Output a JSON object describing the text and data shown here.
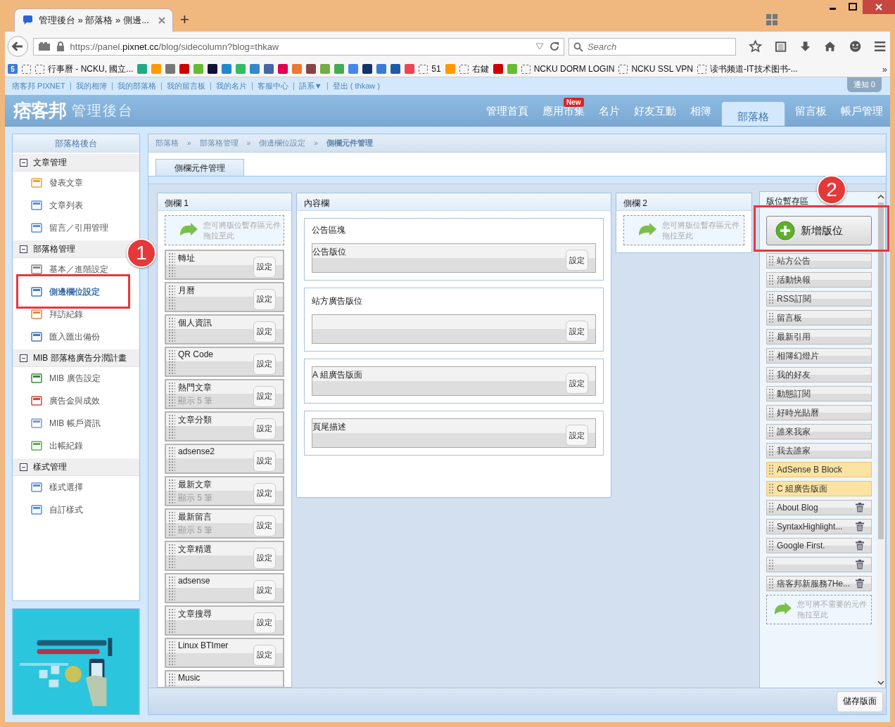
{
  "browser": {
    "tab_title": "管理後台 » 部落格 » 側邊...",
    "new_tab": "+",
    "url_host_pre": "https://panel.",
    "url_host": "pixnet.cc",
    "url_path": "/blog/sidecolumn?blog=thkaw",
    "search_placeholder": "Search",
    "bookmarks": [
      {
        "kind": "icon",
        "label": "5"
      },
      {
        "kind": "link"
      },
      {
        "kind": "link",
        "label": "行事曆 - NCKU, 國立..."
      },
      {
        "kind": "icon"
      },
      {
        "kind": "icon"
      },
      {
        "kind": "icon"
      },
      {
        "kind": "icon"
      },
      {
        "kind": "icon"
      },
      {
        "kind": "icon"
      },
      {
        "kind": "icon"
      },
      {
        "kind": "icon"
      },
      {
        "kind": "icon"
      },
      {
        "kind": "icon"
      },
      {
        "kind": "icon"
      },
      {
        "kind": "icon"
      },
      {
        "kind": "icon"
      },
      {
        "kind": "icon"
      },
      {
        "kind": "icon"
      },
      {
        "kind": "icon"
      },
      {
        "kind": "icon"
      },
      {
        "kind": "icon"
      },
      {
        "kind": "icon"
      },
      {
        "kind": "icon"
      },
      {
        "kind": "link",
        "label": "51"
      },
      {
        "kind": "icon"
      },
      {
        "kind": "link",
        "label": "右鍵"
      },
      {
        "kind": "icon"
      },
      {
        "kind": "icon"
      },
      {
        "kind": "link",
        "label": "NCKU DORM LOGIN"
      },
      {
        "kind": "link",
        "label": "NCKU SSL VPN"
      },
      {
        "kind": "link",
        "label": "读书频道-IT技术图书-..."
      }
    ],
    "overflow": "»"
  },
  "top_links": [
    "痞客邦 PIXNET",
    "我的相簿",
    "我的部落格",
    "我的留言板",
    "我的名片",
    "客服中心",
    "語系▼",
    "登出 ( thkaw )"
  ],
  "notice": "通知 0",
  "header": {
    "logo": "痞客邦",
    "title": "管理後台",
    "nav": [
      {
        "label": "管理首頁",
        "selected": false
      },
      {
        "label": "應用市集",
        "selected": false,
        "badge": "New"
      },
      {
        "label": "名片",
        "selected": false
      },
      {
        "label": "好友互動",
        "selected": false
      },
      {
        "label": "相簿",
        "selected": false
      },
      {
        "label": "部落格",
        "selected": true
      },
      {
        "label": "留言板",
        "selected": false
      },
      {
        "label": "帳戶管理",
        "selected": false
      }
    ]
  },
  "sidebar": {
    "title": "部落格後台",
    "groups": [
      {
        "label": "文章管理",
        "expanded": true,
        "items": [
          {
            "label": "發表文章",
            "selected": false
          },
          {
            "label": "文章列表",
            "selected": false
          },
          {
            "label": "留言／引用管理",
            "selected": false
          }
        ]
      },
      {
        "label": "部落格管理",
        "expanded": true,
        "items": [
          {
            "label": "基本／進階設定",
            "selected": false
          },
          {
            "label": "側邊欄位設定",
            "selected": true,
            "annotation": "1"
          },
          {
            "label": "拜訪紀錄",
            "selected": false
          },
          {
            "label": "匯入匯出備份",
            "selected": false
          }
        ]
      },
      {
        "label": "MIB 部落格廣告分潤計畫",
        "expanded": true,
        "items": [
          {
            "label": "MIB 廣告設定",
            "selected": false
          },
          {
            "label": "廣告金與成效",
            "selected": false
          },
          {
            "label": "MIB 帳戶資訊",
            "selected": false
          },
          {
            "label": "出帳紀錄",
            "selected": false
          }
        ]
      },
      {
        "label": "樣式管理",
        "expanded": true,
        "items": [
          {
            "label": "樣式選擇",
            "selected": false
          },
          {
            "label": "自訂樣式",
            "selected": false
          }
        ]
      }
    ]
  },
  "breadcrumb": {
    "separator": "»",
    "items": [
      "部落格",
      "部落格管理",
      "側邊欄位設定",
      "側欄元件管理"
    ]
  },
  "tabs": [
    {
      "label": "側欄元件管理",
      "selected": true
    }
  ],
  "sidebar1": {
    "title": "側欄 1",
    "drop_hint": "您可將版位暫存區元件拖拉至此",
    "widgets": [
      {
        "label": "轉址",
        "button": "設定"
      },
      {
        "label": "月曆",
        "button": "設定"
      },
      {
        "label": "個人資訊",
        "button": "設定"
      },
      {
        "label": "QR Code",
        "button": "設定"
      },
      {
        "label": "熱門文章",
        "sub": "顯示 5 筆",
        "button": "設定"
      },
      {
        "label": "文章分類",
        "button": "設定"
      },
      {
        "label": "adsense2",
        "button": "設定"
      },
      {
        "label": "最新文章",
        "sub": "顯示 5 筆",
        "button": "設定"
      },
      {
        "label": "最新留言",
        "sub": "顯示 5 筆",
        "button": "設定"
      },
      {
        "label": "文章精選",
        "button": "設定"
      },
      {
        "label": "adsense",
        "button": "設定"
      },
      {
        "label": "文章搜尋",
        "button": "設定"
      },
      {
        "label": "Linux BTImer",
        "button": "設定"
      },
      {
        "label": "Music"
      }
    ]
  },
  "content_column": {
    "title": "內容欄",
    "blocks": [
      {
        "title": "公告區塊",
        "widget": {
          "label": "公告版位",
          "button": "設定"
        }
      },
      {
        "title": "站方廣告版位",
        "widget": {
          "button": "設定"
        }
      },
      {
        "widget": {
          "label": "A 組廣告版面",
          "button": "設定"
        }
      },
      {
        "widget": {
          "label": "頁尾描述",
          "button": "設定"
        }
      }
    ]
  },
  "sidebar2": {
    "title": "側欄 2",
    "drop_hint": "您可將版位暫存區元件拖拉至此"
  },
  "storage": {
    "title": "版位暫存區",
    "add_button": {
      "label": "新增版位",
      "annotation": "2"
    },
    "items": [
      {
        "label": "站方公告",
        "kind": "plain"
      },
      {
        "label": "活動快報",
        "kind": "plain"
      },
      {
        "label": "RSS訂閱",
        "kind": "plain"
      },
      {
        "label": "留言板",
        "kind": "plain"
      },
      {
        "label": "最新引用",
        "kind": "plain"
      },
      {
        "label": "相簿幻燈片",
        "kind": "plain"
      },
      {
        "label": "我的好友",
        "kind": "plain"
      },
      {
        "label": "動態訂閱",
        "kind": "plain"
      },
      {
        "label": "好時光貼曆",
        "kind": "plain"
      },
      {
        "label": "誰來我家",
        "kind": "plain"
      },
      {
        "label": "我去誰家",
        "kind": "plain"
      },
      {
        "label": "AdSense B Block",
        "kind": "highlight"
      },
      {
        "label": "C 組廣告版面",
        "kind": "highlight"
      },
      {
        "label": "About Blog",
        "kind": "removable"
      },
      {
        "label": "SyntaxHighlight...",
        "kind": "removable"
      },
      {
        "label": "Google First.",
        "kind": "removable"
      },
      {
        "kind": "removable"
      },
      {
        "label": "痞客邦新服務7He...",
        "kind": "removable"
      }
    ],
    "drop_hint": "您可將不需要的元件拖拉至此"
  },
  "save_button": "儲存版面"
}
